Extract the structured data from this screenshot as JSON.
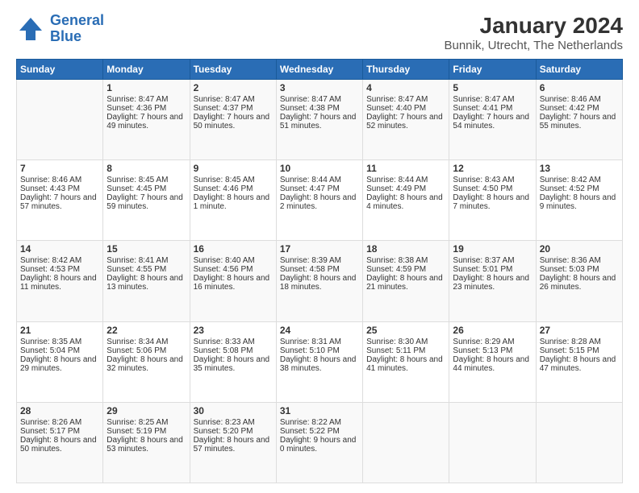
{
  "header": {
    "logo_line1": "General",
    "logo_line2": "Blue",
    "title": "January 2024",
    "subtitle": "Bunnik, Utrecht, The Netherlands"
  },
  "weekdays": [
    "Sunday",
    "Monday",
    "Tuesday",
    "Wednesday",
    "Thursday",
    "Friday",
    "Saturday"
  ],
  "weeks": [
    [
      {
        "day": "",
        "sunrise": "",
        "sunset": "",
        "daylight": ""
      },
      {
        "day": "1",
        "sunrise": "Sunrise: 8:47 AM",
        "sunset": "Sunset: 4:36 PM",
        "daylight": "Daylight: 7 hours and 49 minutes."
      },
      {
        "day": "2",
        "sunrise": "Sunrise: 8:47 AM",
        "sunset": "Sunset: 4:37 PM",
        "daylight": "Daylight: 7 hours and 50 minutes."
      },
      {
        "day": "3",
        "sunrise": "Sunrise: 8:47 AM",
        "sunset": "Sunset: 4:38 PM",
        "daylight": "Daylight: 7 hours and 51 minutes."
      },
      {
        "day": "4",
        "sunrise": "Sunrise: 8:47 AM",
        "sunset": "Sunset: 4:40 PM",
        "daylight": "Daylight: 7 hours and 52 minutes."
      },
      {
        "day": "5",
        "sunrise": "Sunrise: 8:47 AM",
        "sunset": "Sunset: 4:41 PM",
        "daylight": "Daylight: 7 hours and 54 minutes."
      },
      {
        "day": "6",
        "sunrise": "Sunrise: 8:46 AM",
        "sunset": "Sunset: 4:42 PM",
        "daylight": "Daylight: 7 hours and 55 minutes."
      }
    ],
    [
      {
        "day": "7",
        "sunrise": "Sunrise: 8:46 AM",
        "sunset": "Sunset: 4:43 PM",
        "daylight": "Daylight: 7 hours and 57 minutes."
      },
      {
        "day": "8",
        "sunrise": "Sunrise: 8:45 AM",
        "sunset": "Sunset: 4:45 PM",
        "daylight": "Daylight: 7 hours and 59 minutes."
      },
      {
        "day": "9",
        "sunrise": "Sunrise: 8:45 AM",
        "sunset": "Sunset: 4:46 PM",
        "daylight": "Daylight: 8 hours and 1 minute."
      },
      {
        "day": "10",
        "sunrise": "Sunrise: 8:44 AM",
        "sunset": "Sunset: 4:47 PM",
        "daylight": "Daylight: 8 hours and 2 minutes."
      },
      {
        "day": "11",
        "sunrise": "Sunrise: 8:44 AM",
        "sunset": "Sunset: 4:49 PM",
        "daylight": "Daylight: 8 hours and 4 minutes."
      },
      {
        "day": "12",
        "sunrise": "Sunrise: 8:43 AM",
        "sunset": "Sunset: 4:50 PM",
        "daylight": "Daylight: 8 hours and 7 minutes."
      },
      {
        "day": "13",
        "sunrise": "Sunrise: 8:42 AM",
        "sunset": "Sunset: 4:52 PM",
        "daylight": "Daylight: 8 hours and 9 minutes."
      }
    ],
    [
      {
        "day": "14",
        "sunrise": "Sunrise: 8:42 AM",
        "sunset": "Sunset: 4:53 PM",
        "daylight": "Daylight: 8 hours and 11 minutes."
      },
      {
        "day": "15",
        "sunrise": "Sunrise: 8:41 AM",
        "sunset": "Sunset: 4:55 PM",
        "daylight": "Daylight: 8 hours and 13 minutes."
      },
      {
        "day": "16",
        "sunrise": "Sunrise: 8:40 AM",
        "sunset": "Sunset: 4:56 PM",
        "daylight": "Daylight: 8 hours and 16 minutes."
      },
      {
        "day": "17",
        "sunrise": "Sunrise: 8:39 AM",
        "sunset": "Sunset: 4:58 PM",
        "daylight": "Daylight: 8 hours and 18 minutes."
      },
      {
        "day": "18",
        "sunrise": "Sunrise: 8:38 AM",
        "sunset": "Sunset: 4:59 PM",
        "daylight": "Daylight: 8 hours and 21 minutes."
      },
      {
        "day": "19",
        "sunrise": "Sunrise: 8:37 AM",
        "sunset": "Sunset: 5:01 PM",
        "daylight": "Daylight: 8 hours and 23 minutes."
      },
      {
        "day": "20",
        "sunrise": "Sunrise: 8:36 AM",
        "sunset": "Sunset: 5:03 PM",
        "daylight": "Daylight: 8 hours and 26 minutes."
      }
    ],
    [
      {
        "day": "21",
        "sunrise": "Sunrise: 8:35 AM",
        "sunset": "Sunset: 5:04 PM",
        "daylight": "Daylight: 8 hours and 29 minutes."
      },
      {
        "day": "22",
        "sunrise": "Sunrise: 8:34 AM",
        "sunset": "Sunset: 5:06 PM",
        "daylight": "Daylight: 8 hours and 32 minutes."
      },
      {
        "day": "23",
        "sunrise": "Sunrise: 8:33 AM",
        "sunset": "Sunset: 5:08 PM",
        "daylight": "Daylight: 8 hours and 35 minutes."
      },
      {
        "day": "24",
        "sunrise": "Sunrise: 8:31 AM",
        "sunset": "Sunset: 5:10 PM",
        "daylight": "Daylight: 8 hours and 38 minutes."
      },
      {
        "day": "25",
        "sunrise": "Sunrise: 8:30 AM",
        "sunset": "Sunset: 5:11 PM",
        "daylight": "Daylight: 8 hours and 41 minutes."
      },
      {
        "day": "26",
        "sunrise": "Sunrise: 8:29 AM",
        "sunset": "Sunset: 5:13 PM",
        "daylight": "Daylight: 8 hours and 44 minutes."
      },
      {
        "day": "27",
        "sunrise": "Sunrise: 8:28 AM",
        "sunset": "Sunset: 5:15 PM",
        "daylight": "Daylight: 8 hours and 47 minutes."
      }
    ],
    [
      {
        "day": "28",
        "sunrise": "Sunrise: 8:26 AM",
        "sunset": "Sunset: 5:17 PM",
        "daylight": "Daylight: 8 hours and 50 minutes."
      },
      {
        "day": "29",
        "sunrise": "Sunrise: 8:25 AM",
        "sunset": "Sunset: 5:19 PM",
        "daylight": "Daylight: 8 hours and 53 minutes."
      },
      {
        "day": "30",
        "sunrise": "Sunrise: 8:23 AM",
        "sunset": "Sunset: 5:20 PM",
        "daylight": "Daylight: 8 hours and 57 minutes."
      },
      {
        "day": "31",
        "sunrise": "Sunrise: 8:22 AM",
        "sunset": "Sunset: 5:22 PM",
        "daylight": "Daylight: 9 hours and 0 minutes."
      },
      {
        "day": "",
        "sunrise": "",
        "sunset": "",
        "daylight": ""
      },
      {
        "day": "",
        "sunrise": "",
        "sunset": "",
        "daylight": ""
      },
      {
        "day": "",
        "sunrise": "",
        "sunset": "",
        "daylight": ""
      }
    ]
  ]
}
